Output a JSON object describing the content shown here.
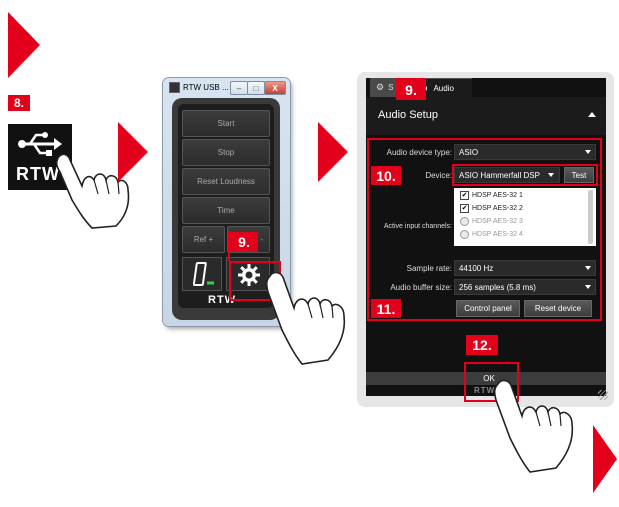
{
  "steps": {
    "step8": "8.",
    "step9_window": "9.",
    "step9_dialog": "9.",
    "step10": "10.",
    "step11": "11.",
    "step12": "12."
  },
  "usb_icon": {
    "name": "usb-icon",
    "logo_text": "RTW"
  },
  "rtw_window": {
    "title": "RTW USB ...",
    "minimize": "–",
    "maximize": "□",
    "close": "X",
    "buttons": [
      "Start",
      "Stop",
      "Reset Loudness",
      "Time"
    ],
    "ref_plus": "Ref +",
    "ref_minus": "f -",
    "device_icon": "device-icon",
    "settings_icon": "gear-icon",
    "logo_text": "RTW"
  },
  "dialog": {
    "tab_settings": "S",
    "tab_audio": "Audio",
    "title": "Audio Setup",
    "device_type_label": "Audio device type:",
    "device_type_value": "ASIO",
    "device_label": "Device:",
    "device_value": "ASIO Hammerfall DSP",
    "test_button": "Test",
    "active_inputs_label": "Active input channels:",
    "channels": [
      {
        "label": "HDSP AES-32 1",
        "checked": true
      },
      {
        "label": "HDSP AES-32 2",
        "checked": true
      },
      {
        "label": "HDSP AES-32 3",
        "checked": false
      },
      {
        "label": "HDSP AES-32 4",
        "checked": false
      }
    ],
    "sample_rate_label": "Sample rate:",
    "sample_rate_value": "44100 Hz",
    "buffer_label": "Audio buffer size:",
    "buffer_value": "256 samples (5.8 ms)",
    "control_panel_button": "Control panel",
    "reset_device_button": "Reset device",
    "ok_button": "OK",
    "footer_logo": "RTW"
  },
  "colors": {
    "accent_red": "#e2001a",
    "dialog_bg": "#111111"
  }
}
